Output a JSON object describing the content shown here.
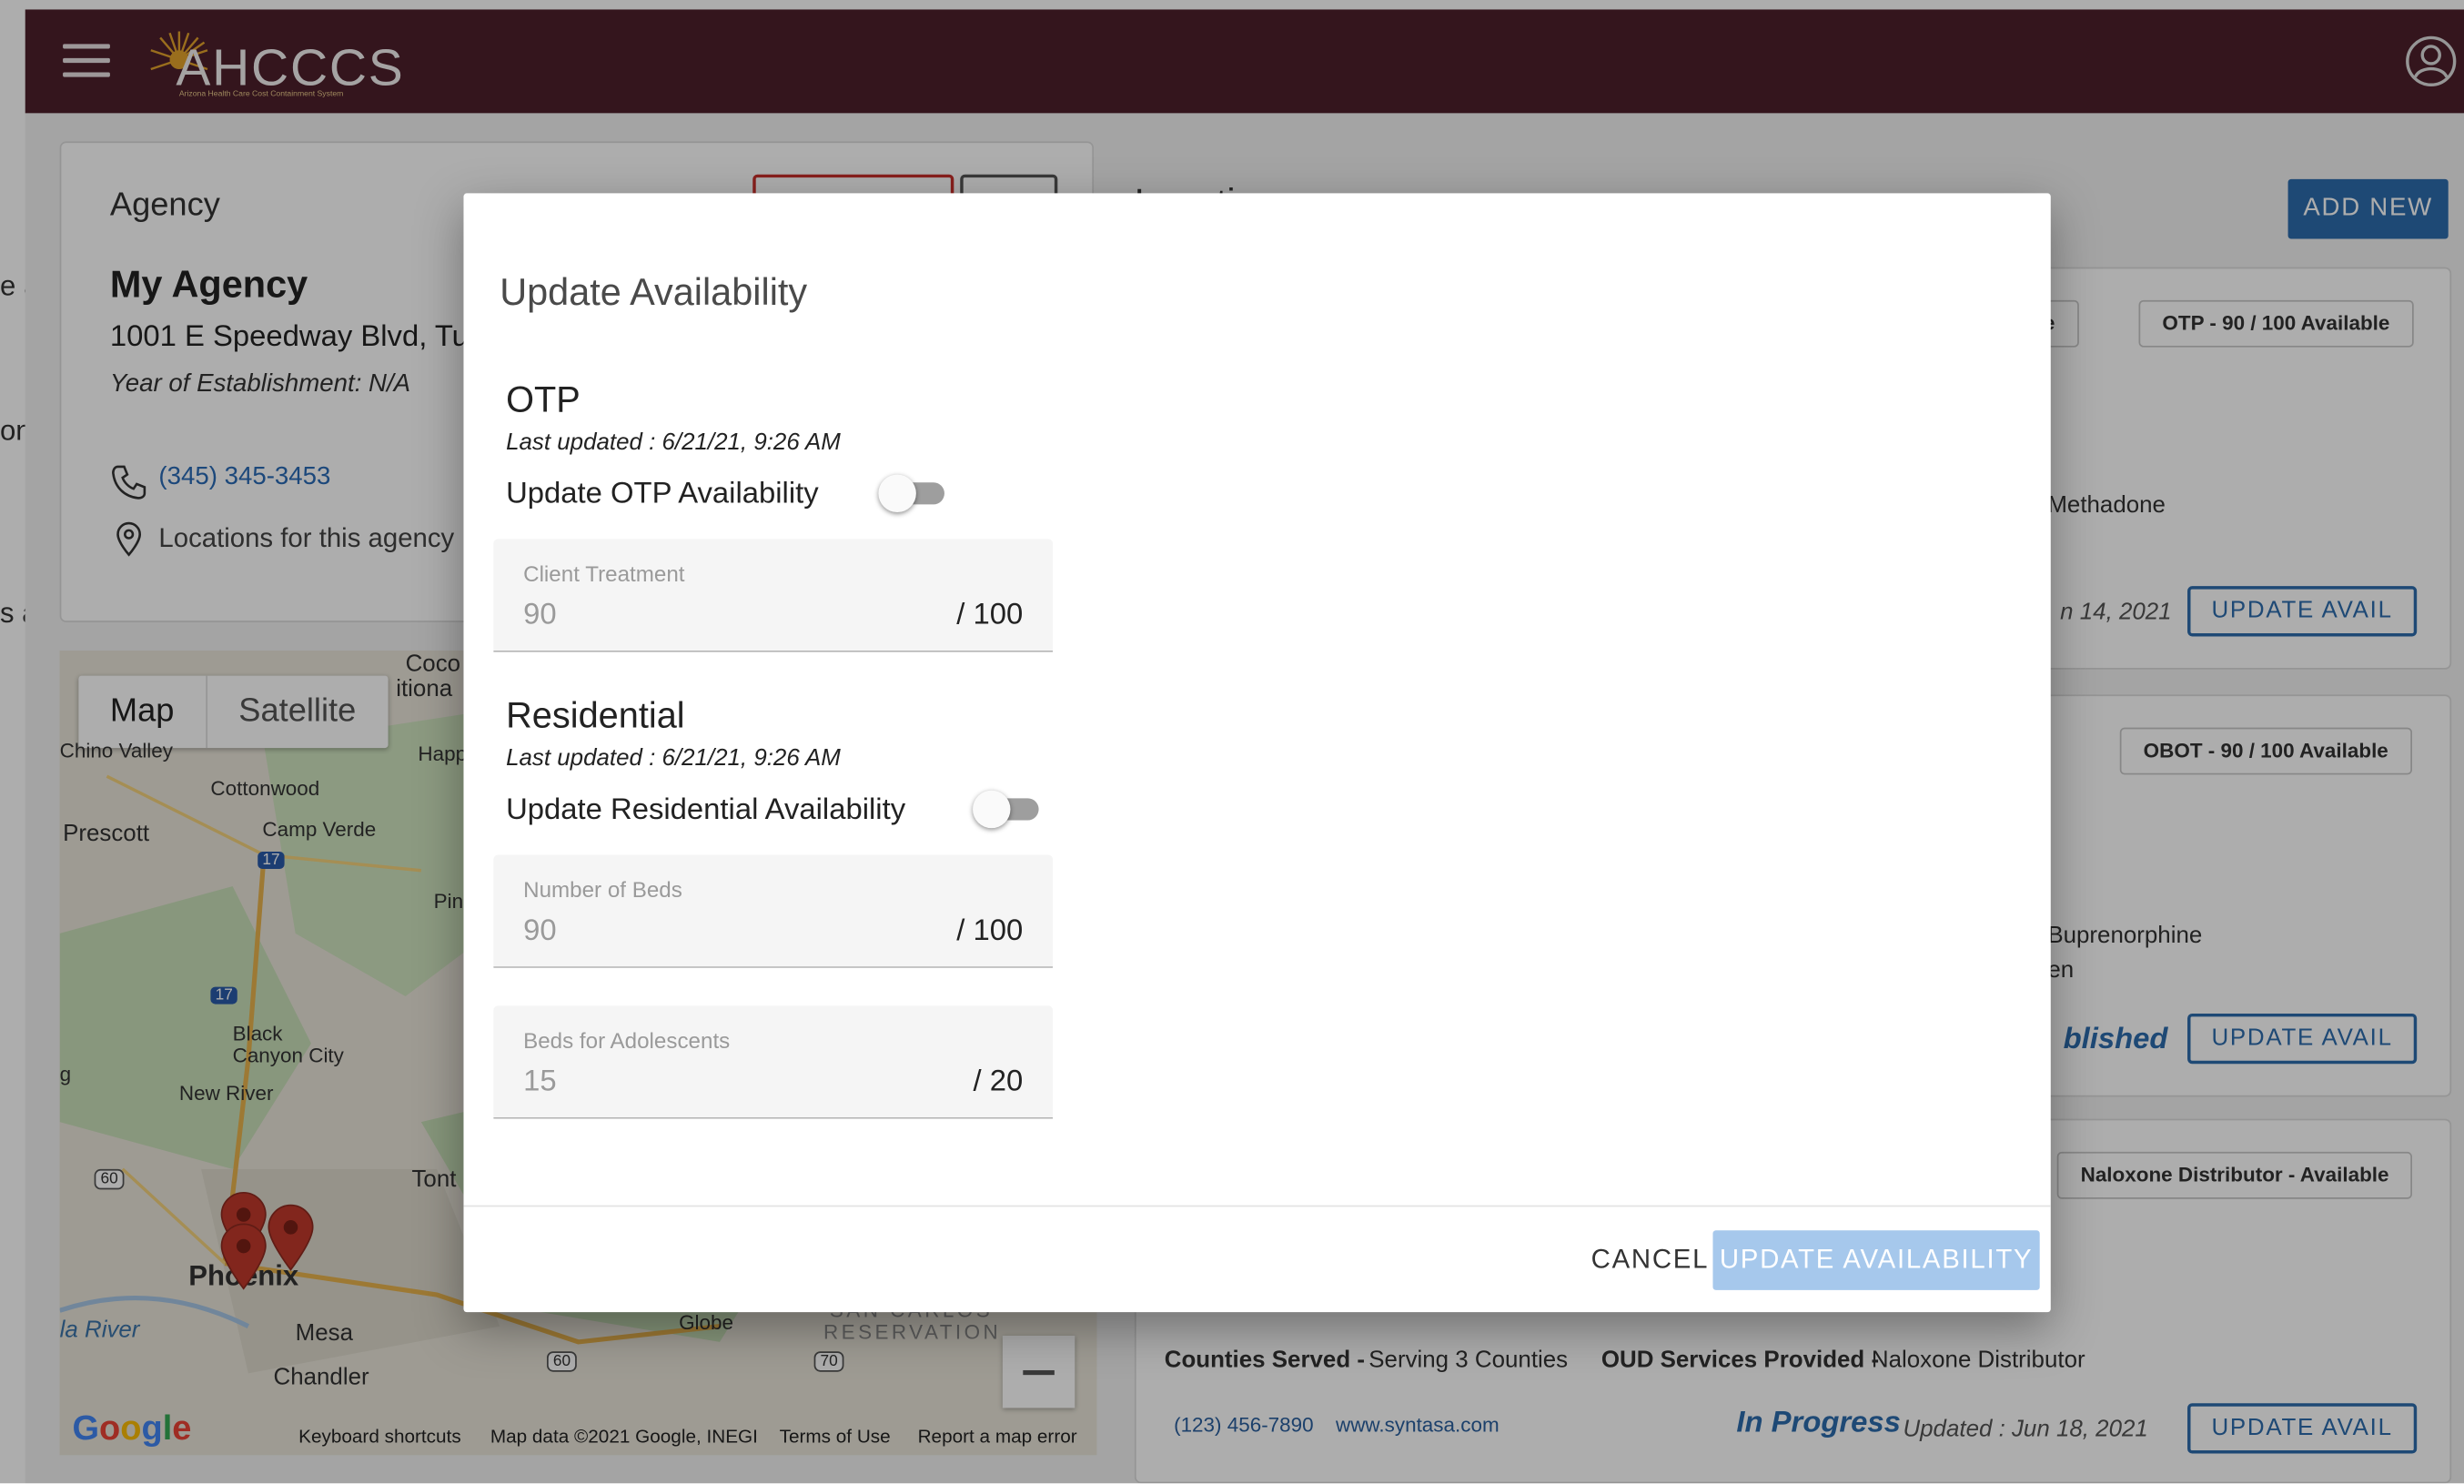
{
  "app": {
    "logo_text": "AHCCCS",
    "logo_subtitle": "Arizona Health Care Cost Containment System"
  },
  "left_stub": [
    "e a",
    "on",
    "s a"
  ],
  "agency": {
    "header": "Agency",
    "name": "My Agency",
    "address": "1001 E Speedway Blvd, Tu",
    "establishment": "Year of Establishment: N/A",
    "phone": "(345) 345-3453",
    "locations_text": "Locations for this agency"
  },
  "map": {
    "tab_map": "Map",
    "tab_satellite": "Satellite",
    "places": {
      "chino_valley": "Chino Valley",
      "cottonwood": "Cottonwood",
      "prescott": "Prescott",
      "camp_verde": "Camp Verde",
      "coco": "Coco",
      "coco2": "itiona",
      "happ": "Happ",
      "pin": "Pin",
      "black_canyon": "Black",
      "black_canyon2": "Canyon City",
      "new_river": "New River",
      "tont": "Tont",
      "phoenix": "Phoenix",
      "mesa": "Mesa",
      "chandler": "Chandler",
      "globe": "Globe",
      "la_river": "la River",
      "san_carlos": "SAN CARLOS",
      "reservation": "RESERVATION",
      "g": "g",
      "r60a": "60",
      "r60b": "60",
      "r70": "70",
      "r17a": "17",
      "r17b": "17"
    },
    "google": "Google",
    "footer": {
      "shortcuts": "Keyboard shortcuts",
      "data": "Map data ©2021 Google, INEGI",
      "terms": "Terms of Use",
      "report": "Report a map error"
    }
  },
  "locations": {
    "title": "Locatio",
    "add_new": "ADD NEW",
    "cards": [
      {
        "pill_left": "lable",
        "pill_right": "OTP - 90 / 100 Available",
        "service": "Methadone",
        "updated": "n 14, 2021",
        "button": "UPDATE AVAIL"
      },
      {
        "pill_right": "OBOT - 90 / 100 Available",
        "service": "Buprenorphine",
        "service2": "en",
        "status": "blished",
        "button": "UPDATE AVAIL"
      },
      {
        "pill_right": "Naloxone Distributor - Available",
        "counties_label": "Counties Served -",
        "counties_value": "Serving 3 Counties",
        "oud_label": "OUD Services Provided -",
        "oud_value": "Naloxone Distributor",
        "phone": "(123) 456-7890",
        "website": "www.syntasa.com",
        "status": "In Progress",
        "updated": "Updated : Jun 18, 2021",
        "button": "UPDATE AVAIL"
      }
    ]
  },
  "modal": {
    "title": "Update Availability",
    "otp": {
      "title": "OTP",
      "last_updated": "Last updated : 6/21/21, 9:26 AM",
      "toggle_label": "Update OTP Availability",
      "toggle_on": false,
      "field_label": "Client Treatment",
      "field_value": "90",
      "field_max": "/ 100"
    },
    "residential": {
      "title": "Residential",
      "last_updated": "Last updated : 6/21/21, 9:26 AM",
      "toggle_label": "Update Residential Availability",
      "toggle_on": false,
      "beds_label": "Number of Beds",
      "beds_value": "90",
      "beds_max": "/ 100",
      "adol_label": "Beds for Adolescents",
      "adol_value": "15",
      "adol_max": "/ 20"
    },
    "cancel": "CANCEL",
    "submit": "UPDATE AVAILABILITY"
  },
  "colors": {
    "appbar": "#4d1f2c",
    "primary": "#2d6cad",
    "submit_disabled": "#a6c8ec",
    "marker": "#c0392b"
  }
}
